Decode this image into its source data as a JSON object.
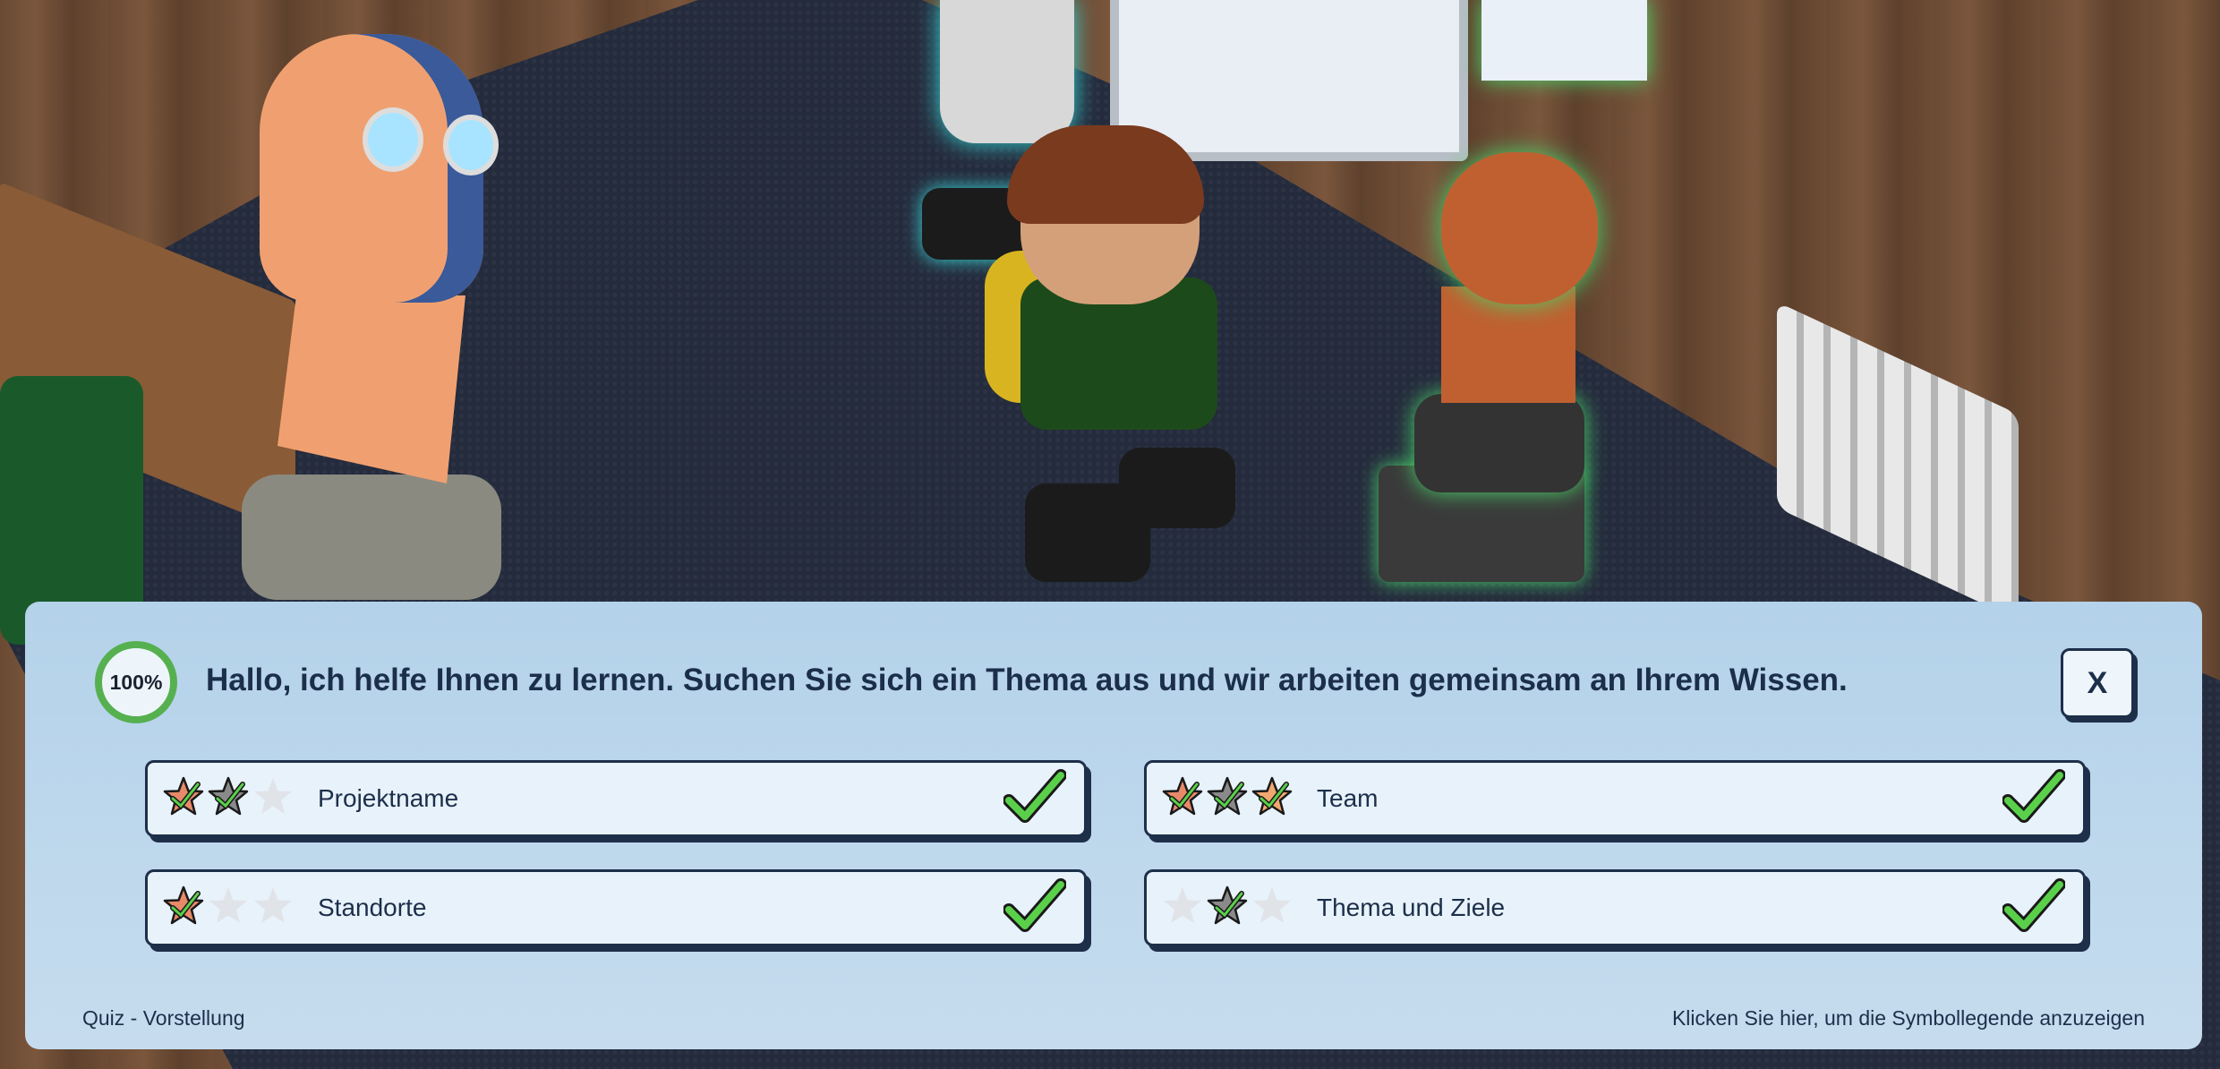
{
  "quiz": {
    "progress_label": "100%",
    "progress_fraction": 1.0,
    "greeting": "Hallo, ich helfe Ihnen zu lernen. Suchen Sie sich ein Thema aus und wir arbeiten gemeinsam an Ihrem Wissen.",
    "close_label": "X",
    "topics": [
      {
        "label": "Projektname",
        "stars": [
          {
            "color": "#e88a6a",
            "checked": true
          },
          {
            "color": "#8a8a8a",
            "checked": true
          },
          {
            "color": "#e0e4e8",
            "checked": false
          }
        ],
        "completed": true
      },
      {
        "label": "Team",
        "stars": [
          {
            "color": "#e88a6a",
            "checked": true
          },
          {
            "color": "#8a8a8a",
            "checked": true
          },
          {
            "color": "#f0a870",
            "checked": true
          }
        ],
        "completed": true
      },
      {
        "label": "Standorte",
        "stars": [
          {
            "color": "#e88a6a",
            "checked": true
          },
          {
            "color": "#e0e4e8",
            "checked": false
          },
          {
            "color": "#e0e4e8",
            "checked": false
          }
        ],
        "completed": true
      },
      {
        "label": "Thema und Ziele",
        "stars": [
          {
            "color": "#e0e4e8",
            "checked": false
          },
          {
            "color": "#8a8a8a",
            "checked": true
          },
          {
            "color": "#e0e4e8",
            "checked": false
          }
        ],
        "completed": true
      }
    ],
    "footer_left": "Quiz - Vorstellung",
    "footer_right": "Klicken Sie hier, um die Symbollegende anzuzeigen"
  },
  "colors": {
    "panel_bg": "#b4d2ea",
    "ring_green": "#56b050",
    "check_green": "#5ad04a",
    "border_navy": "#1e2f4a"
  },
  "icons": {
    "star": "star-icon",
    "check": "checkmark-icon"
  }
}
